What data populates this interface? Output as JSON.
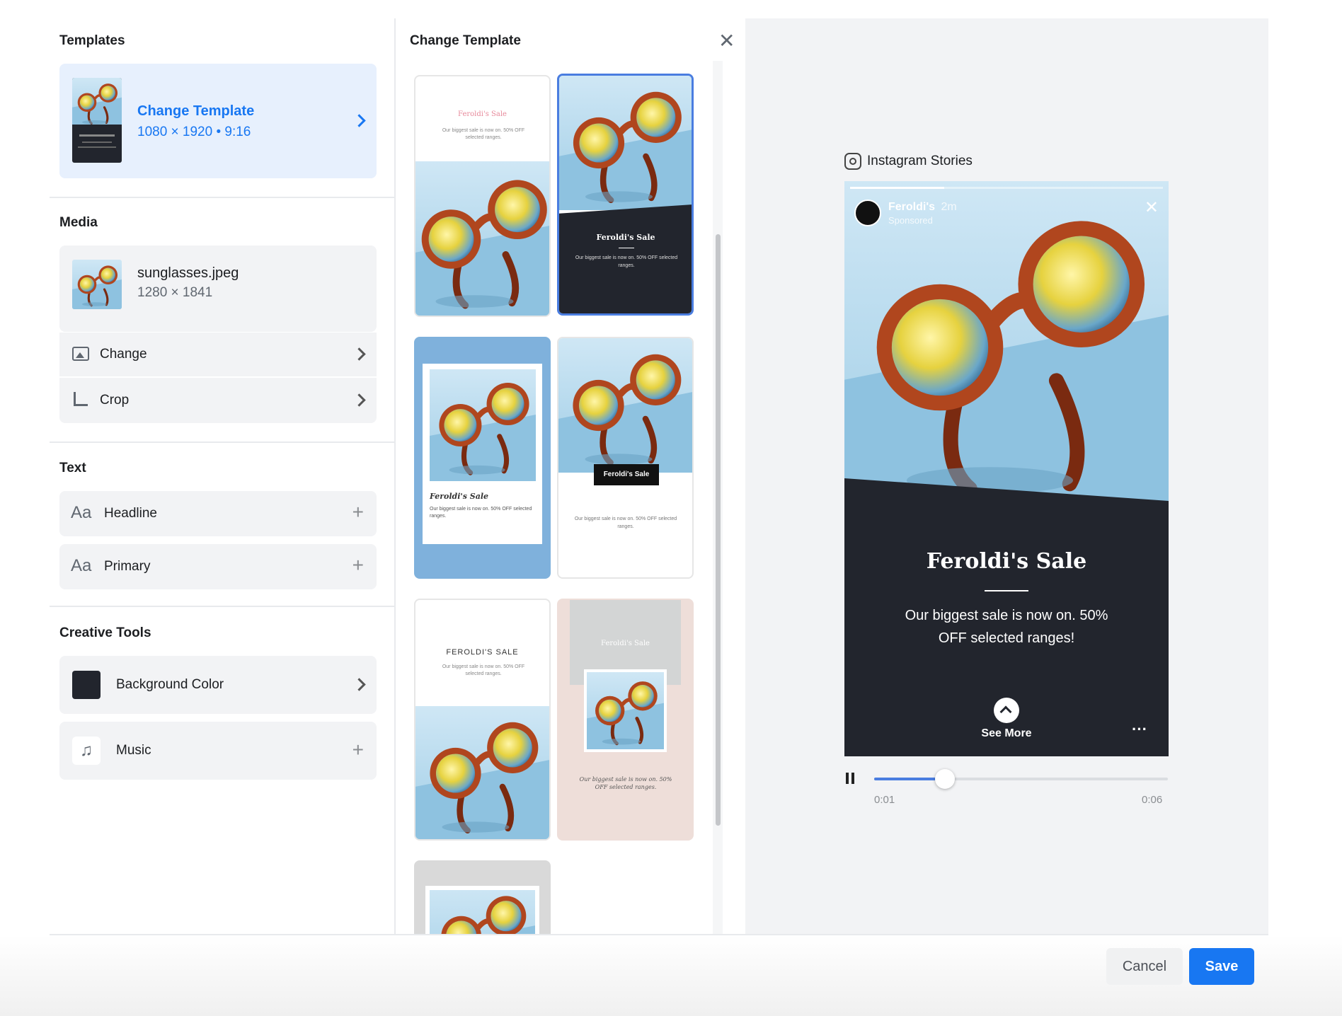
{
  "left": {
    "templates": {
      "title": "Templates",
      "card_title": "Change Template",
      "card_sub": "1080 × 1920 • 9:16"
    },
    "media": {
      "title": "Media",
      "file_name": "sunglasses.jpeg",
      "file_dims": "1280 × 1841",
      "change_label": "Change",
      "crop_label": "Crop"
    },
    "text": {
      "title": "Text",
      "headline_label": "Headline",
      "primary_label": "Primary",
      "aa_glyph": "Aa"
    },
    "creative": {
      "title": "Creative Tools",
      "bg_label": "Background Color",
      "bg_color": "#22252d",
      "music_label": "Music"
    }
  },
  "middle": {
    "title": "Change Template",
    "templates": [
      {
        "headline": "Feroldi's Sale",
        "body": "Our biggest sale is now on. 50% OFF selected ranges."
      },
      {
        "headline": "Feroldi's Sale",
        "body": "Our biggest sale is now on. 50% OFF selected ranges."
      },
      {
        "headline": "Feroldi's Sale",
        "body": "Our biggest sale is now on. 50% OFF selected ranges."
      },
      {
        "headline": "Feroldi's Sale",
        "body": "Our biggest sale is now on. 50% OFF selected ranges."
      },
      {
        "headline": "FEROLDI'S SALE",
        "body": "Our biggest sale is now on. 50% OFF selected ranges."
      },
      {
        "headline": "Feroldi's Sale",
        "body": "Our biggest sale is now on. 50% OFF selected ranges."
      }
    ]
  },
  "preview": {
    "platform": "Instagram Stories",
    "brand": "Feroldi's",
    "time": "2m",
    "sponsored": "Sponsored",
    "headline": "Feroldi's Sale",
    "body_line1": "Our biggest sale is now on. 50%",
    "body_line2": "OFF selected ranges!",
    "see_more": "See More",
    "more_dots": "···",
    "time_current": "0:01",
    "time_total": "0:06",
    "progress": 0.24
  },
  "footer": {
    "cancel": "Cancel",
    "save": "Save"
  },
  "colors": {
    "accent": "#1877f2",
    "dark_panel": "#22252d",
    "lens": "#e9d84a",
    "frame": "#b0461e",
    "sky": "#a9d4ea"
  }
}
